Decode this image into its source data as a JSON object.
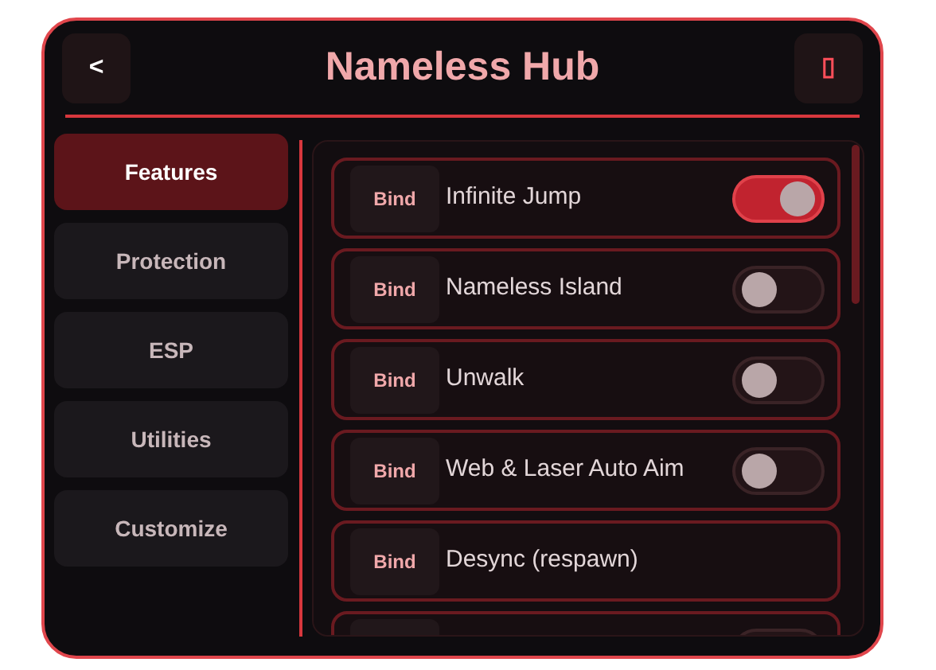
{
  "header": {
    "back": "<",
    "title": "Nameless Hub",
    "close": "▯"
  },
  "sidebar": {
    "items": [
      {
        "label": "Features",
        "selected": true
      },
      {
        "label": "Protection",
        "selected": false
      },
      {
        "label": "ESP",
        "selected": false
      },
      {
        "label": "Utilities",
        "selected": false
      },
      {
        "label": "Customize",
        "selected": false
      }
    ]
  },
  "features": [
    {
      "kind": "toggle",
      "bind": "Bind",
      "label": "Infinite Jump",
      "on": true
    },
    {
      "kind": "toggle",
      "bind": "Bind",
      "label": "Nameless Island",
      "on": false
    },
    {
      "kind": "toggle",
      "bind": "Bind",
      "label": "Unwalk",
      "on": false
    },
    {
      "kind": "toggle",
      "bind": "Bind",
      "label": "Web & Laser Auto Aim",
      "on": false
    },
    {
      "kind": "button",
      "bind": "Bind",
      "label": "Desync (respawn)"
    },
    {
      "kind": "toggle",
      "on": false
    }
  ]
}
